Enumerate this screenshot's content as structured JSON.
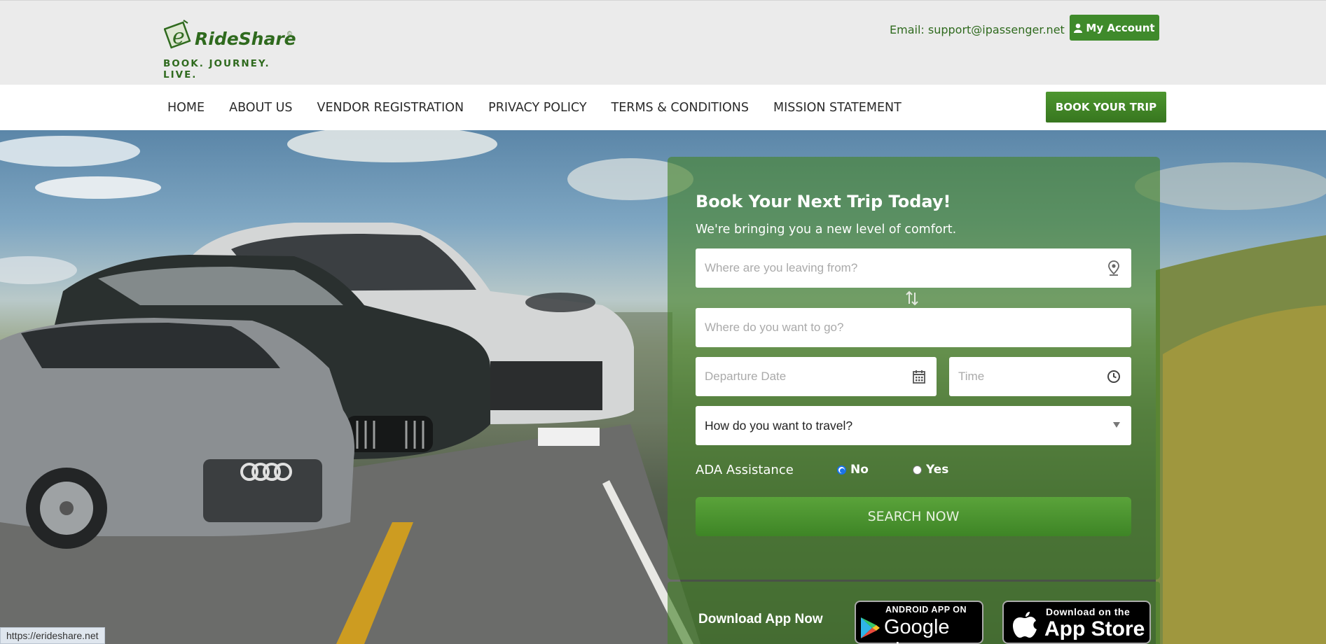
{
  "header": {
    "logo_name": "RideShare",
    "logo_tagline": "BOOK. JOURNEY. LIVE.",
    "email": "Email: support@ipassenger.net",
    "account_label": "My Account"
  },
  "nav": {
    "items": [
      "HOME",
      "ABOUT US",
      "VENDOR REGISTRATION",
      "PRIVACY POLICY",
      "TERMS & CONDITIONS",
      "MISSION STATEMENT"
    ],
    "book_label": "BOOK YOUR TRIP"
  },
  "booking": {
    "title": "Book Your Next Trip Today!",
    "subtitle": "We're bringing you a new level of comfort.",
    "from_placeholder": "Where are you leaving from?",
    "to_placeholder": "Where do you want to go?",
    "date_placeholder": "Departure Date",
    "time_placeholder": "Time",
    "travel_select": "How do you want to travel?",
    "ada_label": "ADA Assistance",
    "ada_no": "No",
    "ada_yes": "Yes",
    "ada_selected": "No",
    "search_label": "SEARCH NOW"
  },
  "apps": {
    "download_text": "Download App Now",
    "google_small": "ANDROID APP ON",
    "google_big": "Google play",
    "apple_small": "Download on the",
    "apple_big": "App Store"
  },
  "status_url": "https://erideshare.net",
  "colors": {
    "brand_green": "#3f8a2b",
    "panel_green": "rgba(70,130,40,0.62)",
    "header_bg": "#ebebeb"
  },
  "icons": [
    "user-icon",
    "map-pin-icon",
    "swap-icon",
    "calendar-icon",
    "clock-icon",
    "dropdown-arrow-icon",
    "google-play-icon",
    "apple-icon"
  ]
}
